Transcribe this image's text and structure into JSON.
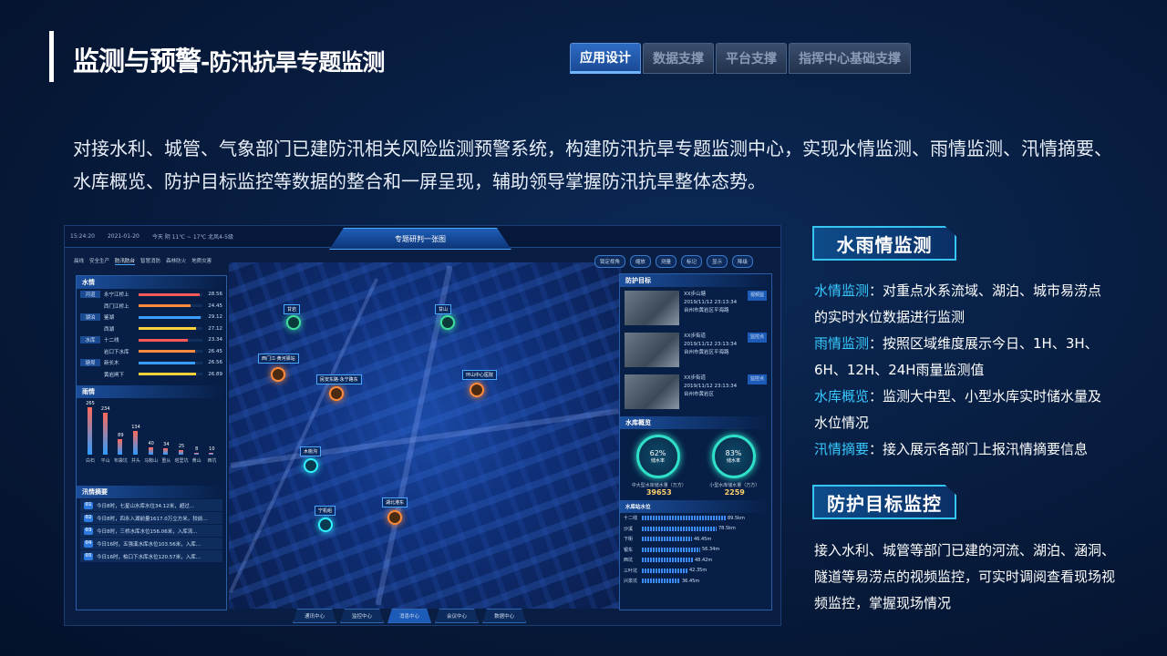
{
  "header": {
    "title_main": "监测与预警",
    "title_sub": "-防汛抗旱专题监测",
    "tabs": [
      "应用设计",
      "数据支撑",
      "平台支撑",
      "指挥中心基础支撑"
    ]
  },
  "intro": "对接水利、城管、气象部门已建防汛相关风险监测预警系统，构建防汛抗旱专题监测中心，实现水情监测、雨情监测、汛情摘要、水库概览、防护目标监控等数据的整合和一屏呈现，辅助领导掌握防汛抗旱整体态势。",
  "screenshot": {
    "time": "15:24:20",
    "date": "2021-01-20",
    "weather": "今天 阴 11℃ ~ 17℃ 北风4-5级",
    "head_title": "专题研判一张图",
    "mini_tabs": [
      "晨线",
      "安全生产",
      "防汛防台",
      "智慧消防",
      "森林防火",
      "地质灾害"
    ],
    "tools": [
      "锁定视角",
      "缩放",
      "测量",
      "标记",
      "显示",
      "降级"
    ],
    "water": {
      "title": "水情",
      "legend": [
        "河道",
        "湖泊",
        "水库",
        "塘坝"
      ],
      "rows": [
        {
          "cat": "河道",
          "name": "永宁江桥上",
          "value": "28.56"
        },
        {
          "cat": "",
          "name": "西门江桥上",
          "value": "24.45"
        },
        {
          "cat": "湖泊",
          "name": "鉴湖",
          "value": "29.12"
        },
        {
          "cat": "",
          "name": "西湖",
          "value": "27.12"
        },
        {
          "cat": "水库",
          "name": "十二线",
          "value": "23.34"
        },
        {
          "cat": "",
          "name": "岩口下水库",
          "value": "26.45"
        },
        {
          "cat": "塘坝",
          "name": "新长木",
          "value": "26.56"
        },
        {
          "cat": "",
          "name": "黄岩闸下",
          "value": "26.89"
        }
      ]
    },
    "rain": {
      "title": "雨情",
      "categories": [
        "白石",
        "平山",
        "布袋坑",
        "井头",
        "马鞍山",
        "重从",
        "塔里坑",
        "黄山",
        "西坑"
      ],
      "values": [
        265,
        234,
        89,
        134,
        40,
        34,
        25,
        8,
        10
      ]
    },
    "summary": {
      "title": "汛情摘要",
      "items": [
        "今日8时，七星山水库水位34.12米，超过...",
        "今日8时，四永入湖前量1617.0万立方米，较前...",
        "今日8时，三桥水库水位156.06米，入库流...",
        "今日16时，五强溪水库水位103.56米，入库...",
        "今日16时，柏口下水库水位120.57米，入库..."
      ]
    },
    "protect": {
      "title": "防护目标",
      "items": [
        {
          "name": "XX步山塘",
          "time": "2019/11/12 23:13:34",
          "addr": "台州市黄岩区平海路",
          "tag": "视频监"
        },
        {
          "name": "XX步街道",
          "time": "2019/11/12 23:13:34",
          "addr": "台州市黄岩区平海路",
          "tag": "监控点"
        },
        {
          "name": "XX步街道",
          "time": "2019/11/12 23:13:34",
          "addr": "台州市黄岩区",
          "tag": "监控点"
        }
      ]
    },
    "reservoir": {
      "title": "水库概览",
      "gauges": [
        {
          "pct": "62%",
          "label": "储水率",
          "caption": "中大型水库储水量（万方）",
          "value": "39653"
        },
        {
          "pct": "83%",
          "label": "储水率",
          "caption": "小型水库储水量（万方）",
          "value": "2259"
        }
      ],
      "level_title": "水库站水位",
      "levels": [
        {
          "name": "十二线",
          "value": "89.5km",
          "pct": 0.92
        },
        {
          "name": "沙溪",
          "value": "78.5km",
          "pct": 0.82
        },
        {
          "name": "下街",
          "value": "46.45m",
          "pct": 0.55
        },
        {
          "name": "银东",
          "value": "56.34m",
          "pct": 0.64
        },
        {
          "name": "西坑",
          "value": "48.42m",
          "pct": 0.56
        },
        {
          "name": "三叶坑",
          "value": "42.35m",
          "pct": 0.5
        },
        {
          "name": "兴泉坑",
          "value": "36.45m",
          "pct": 0.42
        }
      ]
    },
    "map_labels": [
      "甘岩",
      "西门江·黄河驿站",
      "民安东路·永宁路东",
      "环山中心医院",
      "木桃沟",
      "宁机组",
      "湖北港东",
      "甘山"
    ],
    "bottom_nav": [
      "通讯中心",
      "监控中心",
      "消息中心",
      "会议中心",
      "数据中心"
    ]
  },
  "sections": [
    {
      "title": "水雨情监测",
      "items": [
        {
          "k": "水情监测",
          "v": "：对重点水系流域、湖泊、城市易涝点的实时水位数据进行监测"
        },
        {
          "k": "雨情监测",
          "v": "：按照区域维度展示今日、1H、3H、6H、12H、24H雨量监测值"
        },
        {
          "k": "水库概览",
          "v": "：监测大中型、小型水库实时储水量及水位情况"
        },
        {
          "k": "汛情摘要",
          "v": "：接入展示各部门上报汛情摘要信息"
        }
      ]
    },
    {
      "title": "防护目标监控",
      "text": "接入水利、城管等部门已建的河流、湖泊、涵洞、隧道等易涝点的视频监控，可实时调阅查看现场视频监控，掌握现场情况"
    }
  ]
}
